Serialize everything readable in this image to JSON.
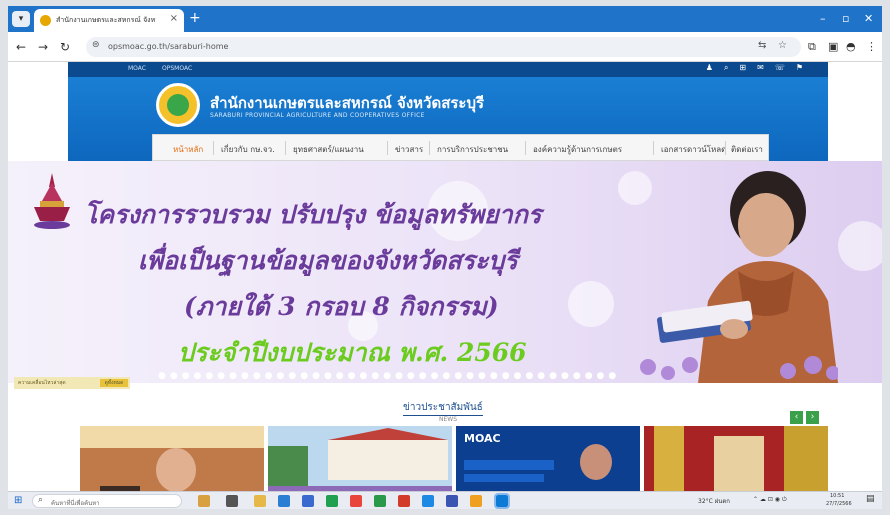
{
  "browser": {
    "tab_title": "สำนักงานเกษตรและสหกรณ์ จังหวัดส...",
    "url": "opsmoac.go.th/saraburi-home",
    "icons": [
      "back-icon",
      "forward-icon",
      "reload-icon",
      "site-settings-icon",
      "translate-icon",
      "star-icon",
      "extensions-icon",
      "menu-icon"
    ]
  },
  "site": {
    "top_links": [
      "MOAC",
      "OPSMOAC"
    ],
    "title": "สำนักงานเกษตรและสหกรณ์ จังหวัดสระบุรี",
    "subtitle": "SARABURI PROVINCIAL AGRICULTURE AND COOPERATIVES OFFICE",
    "nav": [
      "หน้าหลัก",
      "เกี่ยวกับ กษ.จว.",
      "ยุทธศาสตร์/แผนงาน",
      "ข่าวสาร",
      "การบริการประชาชน",
      "องค์ความรู้ด้านการเกษตร",
      "เอกสารดาวน์โหลด",
      "ติดต่อเรา"
    ]
  },
  "banner": {
    "line1": "โครงการรวบรวม ปรับปรุง ข้อมูลทรัพยากร",
    "line2": "เพื่อเป็นฐานข้อมูลของจังหวัดสระบุรี",
    "line3": "(ภายใต้ 3 กรอบ 8 กิจกรรม)",
    "line4": "ประจำปีงบประมาณ พ.ศ. 2566",
    "ticker_label": "ความเคลื่อนไหวล่าสุด",
    "ticker_badge": "ดูทั้งหมด",
    "colors": {
      "purple": "#6a3b9b",
      "green": "#6ccb1f"
    }
  },
  "news": {
    "title": "ข่าวประชาสัมพันธ์",
    "subtitle": "NEWS",
    "card3_brand": "MOAC"
  },
  "taskbar": {
    "search_placeholder": "ค้นหาที่นี่เพื่อค้นหา",
    "weather": "32°C ฝนตก",
    "time": "10:51",
    "date": "27/7/2566"
  }
}
